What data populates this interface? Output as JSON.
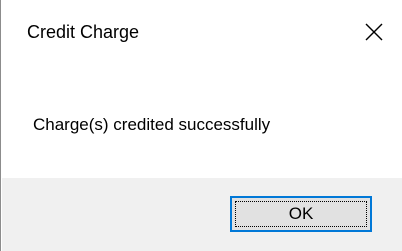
{
  "dialog": {
    "title": "Credit Charge",
    "message": "Charge(s) credited successfully",
    "ok_label": "OK",
    "close_icon": "close-icon"
  },
  "colors": {
    "button_bar_bg": "#f0f0f0",
    "button_bg": "#e1e1e1",
    "focus_border": "#0078d7"
  }
}
